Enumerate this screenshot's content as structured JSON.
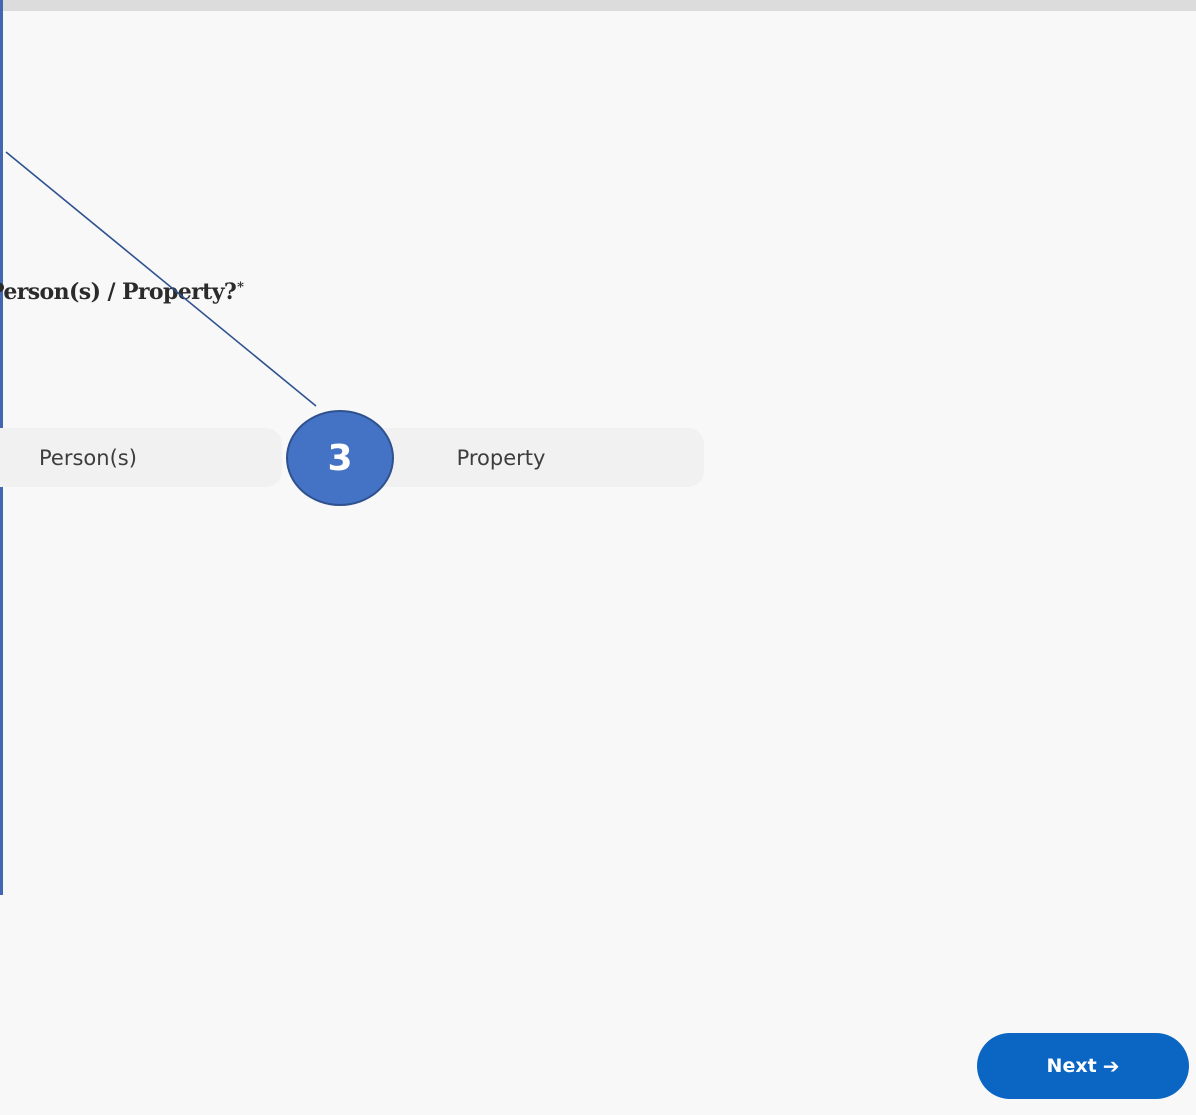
{
  "question": {
    "text": "Person(s) / Property?",
    "required_marker": "*"
  },
  "options": [
    {
      "label": "Person(s)"
    },
    {
      "label": "Property"
    }
  ],
  "callout": {
    "step_number": "3",
    "badge_color": "#4472c4",
    "line_color": "#2f528f"
  },
  "footer": {
    "next_label": "Next",
    "next_icon": "arrow-right-icon",
    "next_color": "#0a66c2"
  }
}
